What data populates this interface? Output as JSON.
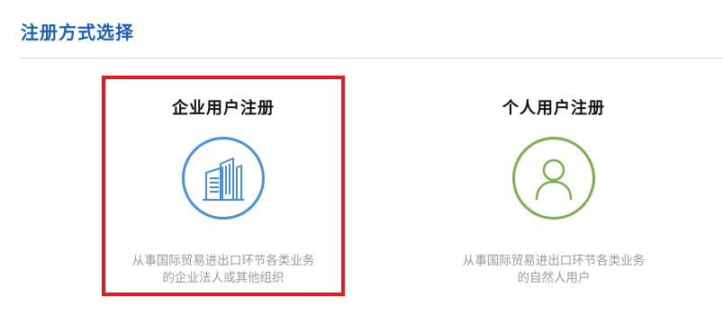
{
  "page": {
    "title": "注册方式选择"
  },
  "options": [
    {
      "title": "企业用户注册",
      "icon": "building-icon",
      "accent": "#4a8fdc",
      "selected": true,
      "description_line1": "从事国际贸易进出口环节各类业务",
      "description_line2": "的企业法人或其他组织"
    },
    {
      "title": "个人用户注册",
      "icon": "user-icon",
      "accent": "#7ab04a",
      "selected": false,
      "description_line1": "从事国际贸易进出口环节各类业务",
      "description_line2": "的自然人用户"
    }
  ],
  "colors": {
    "title": "#1a5fb4",
    "selection_border": "#e01b24",
    "description": "#9a9a9a",
    "divider": "#d9d9d9"
  }
}
